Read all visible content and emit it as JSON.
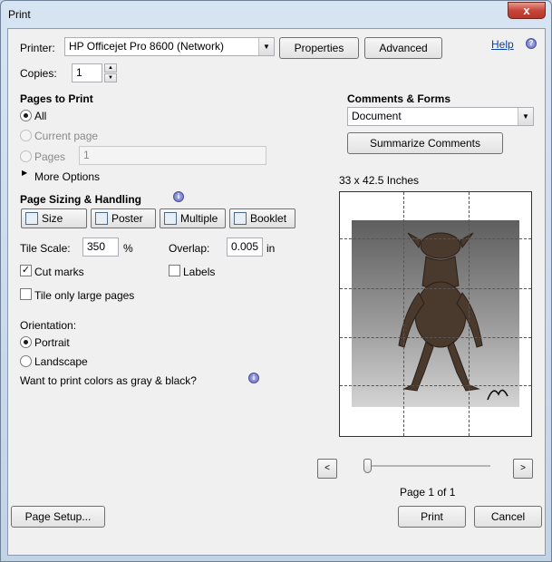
{
  "window": {
    "title": "Print",
    "close": "x"
  },
  "printer": {
    "label": "Printer:",
    "selected": "HP Officejet Pro 8600 (Network)",
    "properties": "Properties",
    "advanced": "Advanced",
    "help": "Help"
  },
  "copies": {
    "label": "Copies:",
    "value": "1"
  },
  "pages": {
    "heading": "Pages to Print",
    "all": "All",
    "current": "Current page",
    "pages_label": "Pages",
    "pages_value": "1",
    "more_options": "More Options"
  },
  "sizing": {
    "heading": "Page Sizing & Handling",
    "tabs": [
      "Size",
      "Poster",
      "Multiple",
      "Booklet"
    ],
    "tile_scale_label": "Tile Scale:",
    "tile_scale_value": "350",
    "percent": "%",
    "overlap_label": "Overlap:",
    "overlap_value": "0.005",
    "overlap_unit": "in",
    "cut_marks": "Cut marks",
    "labels": "Labels",
    "tile_large": "Tile only large pages"
  },
  "orientation": {
    "label": "Orientation:",
    "portrait": "Portrait",
    "landscape": "Landscape",
    "gray_question": "Want to print colors as gray & black?"
  },
  "comments": {
    "heading": "Comments & Forms",
    "selected": "Document",
    "summarize": "Summarize Comments"
  },
  "preview": {
    "size": "33 x 42.5 Inches",
    "page_status": "Page 1 of 1",
    "prev": "<",
    "next": ">"
  },
  "footer": {
    "page_setup": "Page Setup...",
    "print": "Print",
    "cancel": "Cancel"
  }
}
